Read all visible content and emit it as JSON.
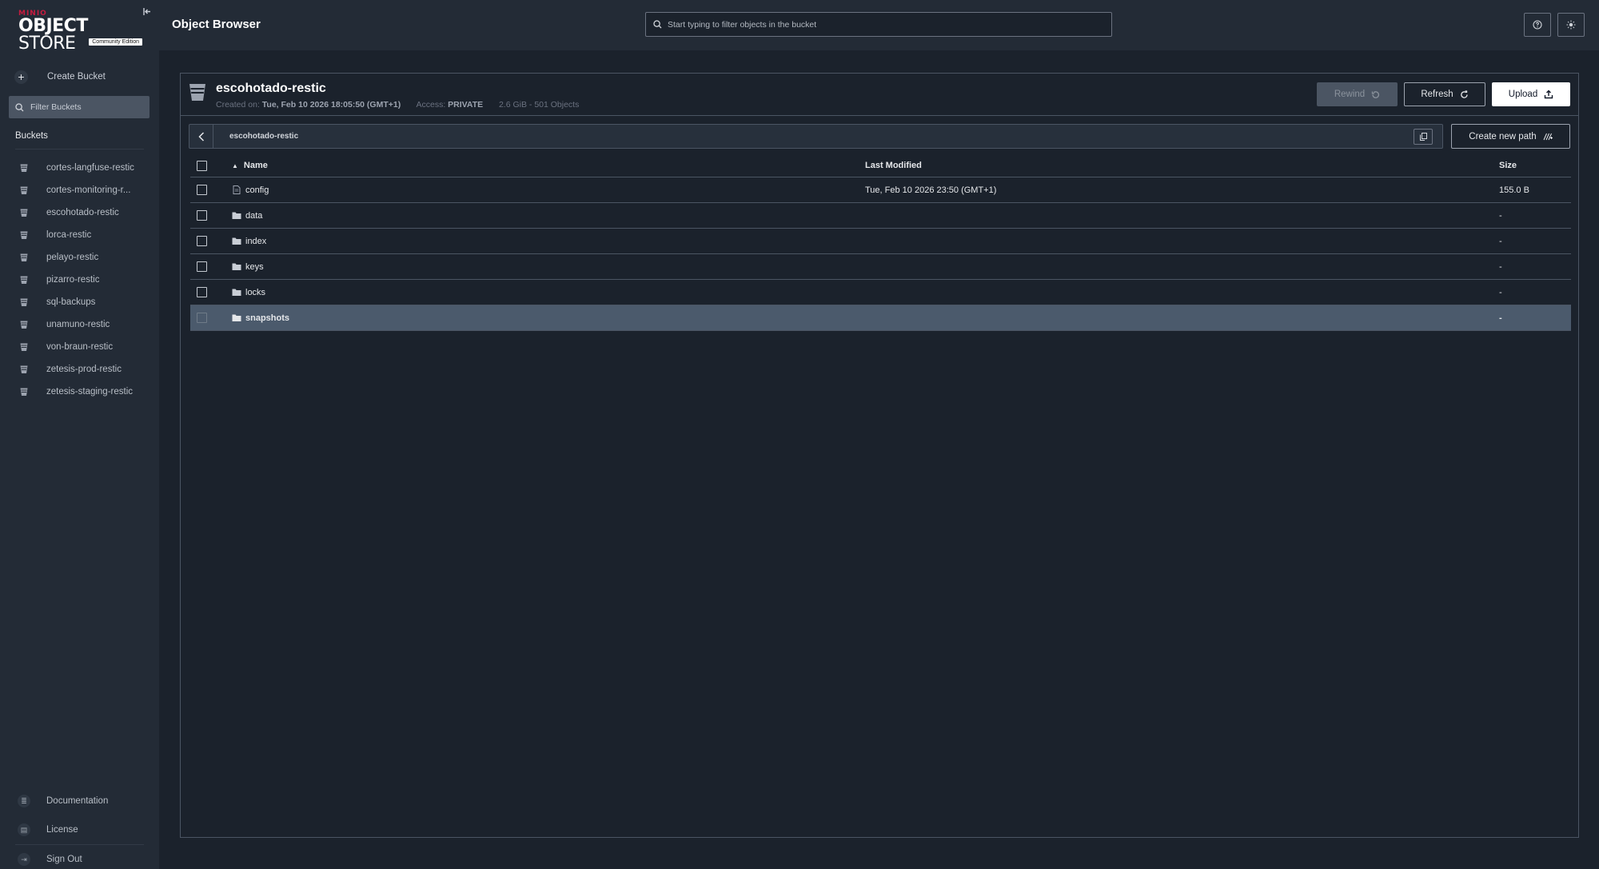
{
  "brand": {
    "maker": "MINIO",
    "product_bold": "OBJECT",
    "product_thin": "STORE",
    "edition": "Community Edition"
  },
  "sidebar": {
    "create_bucket_label": "Create Bucket",
    "filter_placeholder": "Filter Buckets",
    "buckets_heading": "Buckets",
    "buckets": [
      {
        "label": "cortes-langfuse-restic"
      },
      {
        "label": "cortes-monitoring-r..."
      },
      {
        "label": "escohotado-restic"
      },
      {
        "label": "lorca-restic"
      },
      {
        "label": "pelayo-restic"
      },
      {
        "label": "pizarro-restic"
      },
      {
        "label": "sql-backups"
      },
      {
        "label": "unamuno-restic"
      },
      {
        "label": "von-braun-restic"
      },
      {
        "label": "zetesis-prod-restic"
      },
      {
        "label": "zetesis-staging-restic"
      }
    ],
    "bottom": {
      "documentation": "Documentation",
      "license": "License",
      "sign_out": "Sign Out"
    }
  },
  "header": {
    "title": "Object Browser",
    "search_placeholder": "Start typing to filter objects in the bucket"
  },
  "bucket": {
    "name": "escohotado-restic",
    "created_label": "Created on:",
    "created_value": "Tue, Feb 10 2026 18:05:50 (GMT+1)",
    "access_label": "Access:",
    "access_value": "PRIVATE",
    "usage": "2.6 GiB - 501 Objects"
  },
  "actions": {
    "rewind": "Rewind",
    "refresh": "Refresh",
    "upload": "Upload",
    "create_new_path": "Create new path"
  },
  "breadcrumb": {
    "path": "escohotado-restic"
  },
  "table": {
    "columns": {
      "name": "Name",
      "last_modified": "Last Modified",
      "size": "Size"
    },
    "rows": [
      {
        "name": "config",
        "type": "file",
        "last_modified": "Tue, Feb 10 2026 23:50 (GMT+1)",
        "size": "155.0 B"
      },
      {
        "name": "data",
        "type": "folder",
        "last_modified": "",
        "size": "-"
      },
      {
        "name": "index",
        "type": "folder",
        "last_modified": "",
        "size": "-"
      },
      {
        "name": "keys",
        "type": "folder",
        "last_modified": "",
        "size": "-"
      },
      {
        "name": "locks",
        "type": "folder",
        "last_modified": "",
        "size": "-"
      },
      {
        "name": "snapshots",
        "type": "folder",
        "last_modified": "",
        "size": "-",
        "selected": true
      }
    ]
  },
  "colors": {
    "background": "#1b222c",
    "sidebar": "#232b36",
    "brand_red": "#c51c3f",
    "selected_row": "#4b5a6c"
  }
}
